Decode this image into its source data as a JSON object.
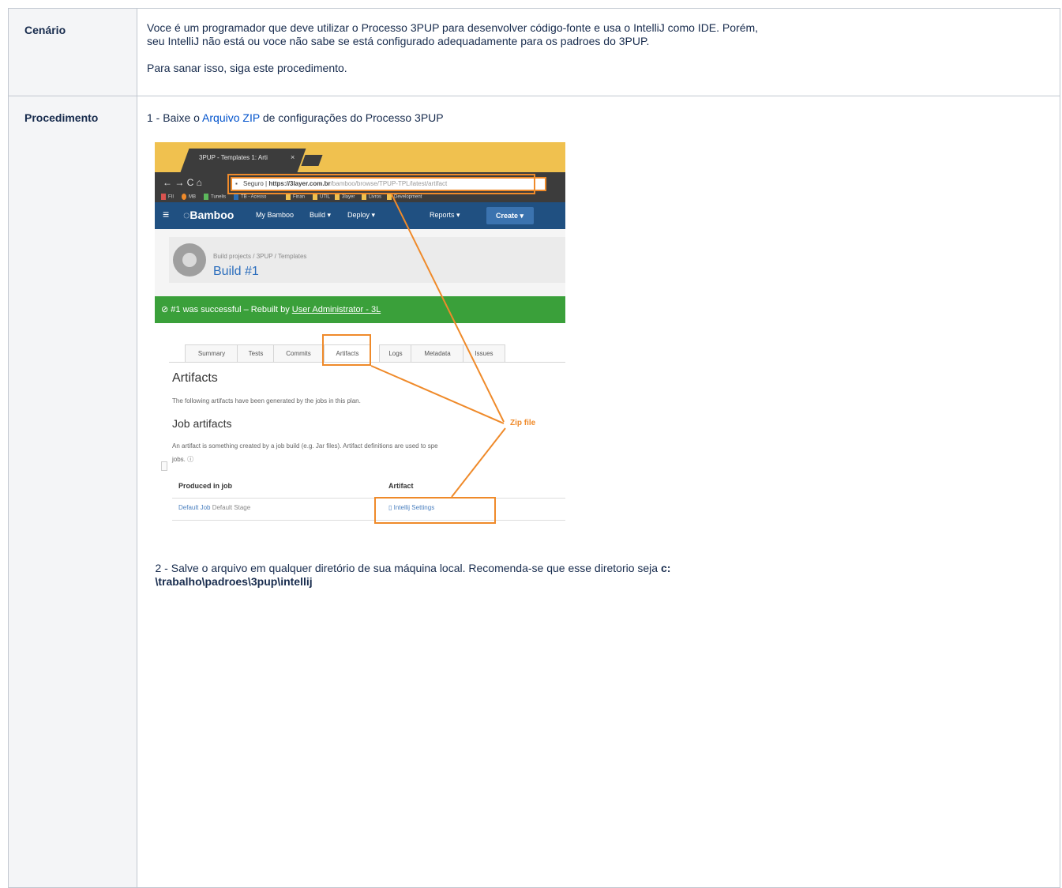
{
  "scenario": {
    "label": "Cenário",
    "line1": "Voce é um programador que deve utilizar o Processo 3PUP para desenvolver código-fonte e usa o IntelliJ como IDE. Porém,",
    "line2": "seu IntelliJ não está ou voce não sabe se está configurado adequadamente para os padroes do 3PUP.",
    "line3": "Para sanar isso, siga este procedimento."
  },
  "procedure": {
    "label": "Procedimento",
    "step1_prefix": "1 - Baixe o ",
    "step1_link": "Arquivo ZIP",
    "step1_suffix": " de configurações do Processo 3PUP",
    "step2_text": "2 - Salve o arquivo em qualquer diretório de sua máquina local. Recomenda-se que esse diretorio seja ",
    "step2_path1": "c:",
    "step2_path2": "\\trabalho\\padroes\\3pup\\intellij"
  },
  "screenshot": {
    "tab_title": "3PUP - Templates 1: Arti",
    "tab_close": "×",
    "nav_icons": "← → C ⌂",
    "url_secure": "Seguro",
    "url_host": "https://3layer.com.br",
    "url_path": "/bamboo/browse/TPUP-TPL/latest/artifact",
    "bookmarks": [
      "FII",
      "MB",
      "Tunelis",
      "TB - Acesso",
      "Finan",
      "UTIL",
      "3layer",
      "Livros",
      "Development"
    ],
    "nav_menu": "≡",
    "brand": "Bamboo",
    "nav_items": [
      "My Bamboo",
      "Build ▾",
      "Deploy ▾",
      "Reports ▾"
    ],
    "create_label": "Create ▾",
    "breadcrumb": "Build projects  /  3PUP  /  Templates",
    "build_title": "Build #1",
    "status_text": "#1 was successful – Rebuilt by ",
    "status_user": "User Administrator - 3L",
    "tabs": [
      "Summary",
      "Tests",
      "Commits",
      "Artifacts",
      "Logs",
      "Metadata",
      "Issues"
    ],
    "artifacts_title": "Artifacts",
    "artifacts_desc": "The following artifacts have been generated by the jobs in this plan.",
    "job_artifacts_title": "Job artifacts",
    "job_artifacts_desc": "An artifact is something created by a job build (e.g. Jar files). Artifact definitions are used to spe",
    "job_artifacts_desc2": "jobs. ⓘ",
    "col_produced": "Produced in job",
    "col_artifact": "Artifact",
    "row_job": "Default Job",
    "row_stage": " Default Stage",
    "row_artifact": "Intellij Settings",
    "annotation": "Zip file"
  },
  "colors": {
    "link": "#0052cc",
    "annotation": "#ef8a2a",
    "bamboo_nav": "#205081",
    "success": "#3aa03a"
  }
}
